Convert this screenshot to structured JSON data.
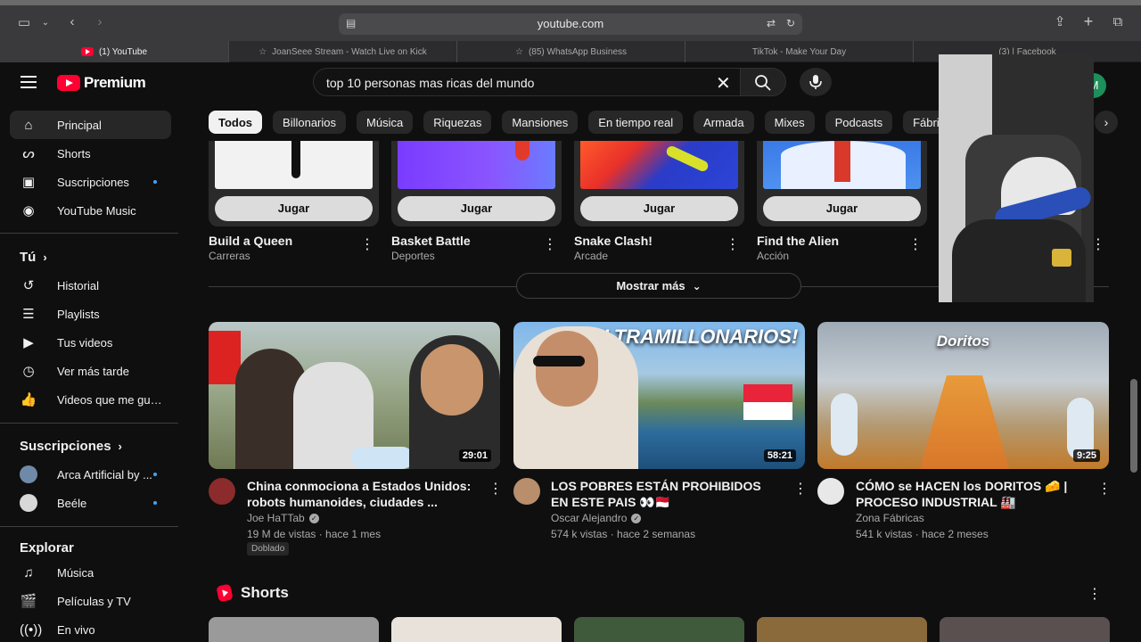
{
  "browser": {
    "url": "youtube.com",
    "tabs": [
      {
        "label": "(1) YouTube",
        "active": true
      },
      {
        "label": "JoanSeee Stream - Watch Live on Kick",
        "active": false
      },
      {
        "label": "(85) WhatsApp Business",
        "active": false
      },
      {
        "label": "TikTok - Make Your Day",
        "active": false
      },
      {
        "label": "(3) | Facebook",
        "active": false
      }
    ]
  },
  "header": {
    "logo_text": "Premium",
    "search_value": "top 10 personas mas ricas del mundo",
    "avatar_letter": "M"
  },
  "sidebar": {
    "main": [
      {
        "label": "Principal",
        "icon": "home-icon",
        "active": true
      },
      {
        "label": "Shorts",
        "icon": "shorts-icon"
      },
      {
        "label": "Suscripciones",
        "icon": "subscriptions-icon",
        "dot": true
      },
      {
        "label": "YouTube Music",
        "icon": "music-icon"
      }
    ],
    "you_heading": "Tú",
    "you": [
      {
        "label": "Historial",
        "icon": "history-icon"
      },
      {
        "label": "Playlists",
        "icon": "playlists-icon"
      },
      {
        "label": "Tus videos",
        "icon": "your-videos-icon"
      },
      {
        "label": "Ver más tarde",
        "icon": "watch-later-icon"
      },
      {
        "label": "Videos que me gus...",
        "icon": "liked-icon"
      }
    ],
    "subs_heading": "Suscripciones",
    "subs": [
      {
        "label": "Arca Artificial by ...",
        "dot": true
      },
      {
        "label": "Beéle",
        "dot": true
      }
    ],
    "explore_heading": "Explorar",
    "explore": [
      {
        "label": "Música",
        "icon": "music-note-icon"
      },
      {
        "label": "Películas y TV",
        "icon": "movies-icon"
      },
      {
        "label": "En vivo",
        "icon": "live-icon"
      }
    ]
  },
  "chips": [
    "Todos",
    "Billonarios",
    "Música",
    "Riquezas",
    "Mansiones",
    "En tiempo real",
    "Armada",
    "Mixes",
    "Podcasts",
    "Fábricas"
  ],
  "games": {
    "play_label": "Jugar",
    "items": [
      {
        "title": "Build a Queen",
        "category": "Carreras"
      },
      {
        "title": "Basket Battle",
        "category": "Deportes"
      },
      {
        "title": "Snake Clash!",
        "category": "Arcade"
      },
      {
        "title": "Find the Alien",
        "category": "Acción"
      }
    ]
  },
  "show_more": "Mostrar más",
  "videos": [
    {
      "title": "China conmociona a Estados Unidos: robots humanoides, ciudades ...",
      "channel": "Joe HaTTab",
      "meta": "19 M de vistas · hace 1 mes",
      "duration": "29:01",
      "badge": "Doblado"
    },
    {
      "title": "LOS POBRES ESTÁN PROHIBIDOS EN ESTE PAIS 👀🇲🇨",
      "channel": "Oscar Alejandro",
      "meta": "574 k vistas · hace 2 semanas",
      "duration": "58:21",
      "banner": "¡ULTRAMILLONARIOS!"
    },
    {
      "title": "CÓMO se HACEN los DORITOS 🧀 | PROCESO INDUSTRIAL 🏭",
      "channel": "Zona Fábricas",
      "meta": "541 k vistas · hace 2 meses",
      "duration": "9:25",
      "banner": "Doritos"
    }
  ],
  "shorts_title": "Shorts",
  "colors": {
    "accent": "#ff0033",
    "background": "#0f0f0f",
    "dot": "#3ea6ff"
  }
}
